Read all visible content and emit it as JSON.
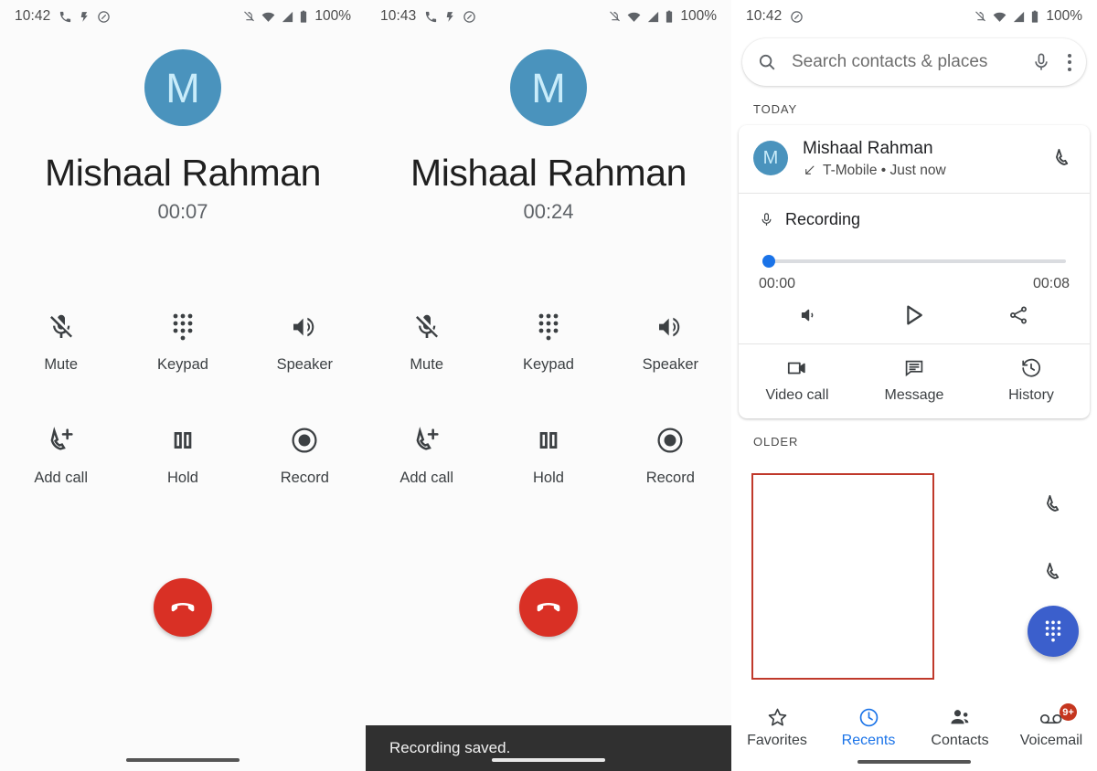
{
  "panels": {
    "call_a": {
      "status": {
        "time": "10:42",
        "battery": "100%",
        "icons_left": [
          "phone-icon",
          "bolt-icon",
          "do-not-disturb-icon"
        ],
        "icons_right": [
          "notifications-off-icon",
          "wifi-icon",
          "signal-icon",
          "battery-icon"
        ]
      },
      "avatar_letter": "M",
      "name": "Mishaal Rahman",
      "timer": "00:07",
      "controls": [
        {
          "label": "Mute",
          "icon": "mic-off-icon"
        },
        {
          "label": "Keypad",
          "icon": "dialpad-icon"
        },
        {
          "label": "Speaker",
          "icon": "speaker-icon"
        },
        {
          "label": "Add call",
          "icon": "add-call-icon"
        },
        {
          "label": "Hold",
          "icon": "pause-icon"
        },
        {
          "label": "Record",
          "icon": "record-icon"
        }
      ],
      "end_call_icon": "call-end-icon"
    },
    "call_b": {
      "status": {
        "time": "10:43",
        "battery": "100%"
      },
      "avatar_letter": "M",
      "name": "Mishaal Rahman",
      "timer": "00:24",
      "controls": [
        {
          "label": "Mute",
          "icon": "mic-off-icon"
        },
        {
          "label": "Keypad",
          "icon": "dialpad-icon"
        },
        {
          "label": "Speaker",
          "icon": "speaker-icon"
        },
        {
          "label": "Add call",
          "icon": "add-call-icon"
        },
        {
          "label": "Hold",
          "icon": "pause-icon"
        },
        {
          "label": "Record",
          "icon": "record-icon"
        }
      ],
      "end_call_icon": "call-end-icon",
      "toast": "Recording saved."
    },
    "recents": {
      "status": {
        "time": "10:42",
        "battery": "100%"
      },
      "search": {
        "placeholder": "Search contacts & places",
        "value": ""
      },
      "sections": {
        "today": "TODAY",
        "older": "OLDER"
      },
      "entry": {
        "avatar_letter": "M",
        "name": "Mishaal Rahman",
        "subtitle": "T-Mobile • Just now",
        "direction_icon": "call-received-icon",
        "call_back_icon": "phone-icon"
      },
      "recording": {
        "title": "Recording",
        "mic_icon": "mic-icon",
        "elapsed": "00:00",
        "duration": "00:08",
        "progress_percent": 0,
        "volume_icon": "volume-icon",
        "play_icon": "play-icon",
        "share_icon": "share-icon"
      },
      "actions": [
        {
          "label": "Video call",
          "icon": "video-call-icon"
        },
        {
          "label": "Message",
          "icon": "message-icon"
        },
        {
          "label": "History",
          "icon": "history-icon"
        }
      ],
      "older_items": [
        {
          "redacted": true,
          "call_icon": "phone-icon"
        },
        {
          "redacted": true,
          "call_icon": "phone-icon"
        }
      ],
      "fab": {
        "icon": "dialpad-icon",
        "color": "#3b5fcc"
      },
      "nav": [
        {
          "label": "Favorites",
          "icon": "star-icon",
          "active": false,
          "badge": ""
        },
        {
          "label": "Recents",
          "icon": "clock-icon",
          "active": true,
          "badge": ""
        },
        {
          "label": "Contacts",
          "icon": "people-icon",
          "active": false,
          "badge": ""
        },
        {
          "label": "Voicemail",
          "icon": "voicemail-icon",
          "active": false,
          "badge": "9+"
        }
      ]
    }
  },
  "colors": {
    "avatar_blue": "#4a93bd",
    "avatar_letter": "#c9ecfa",
    "end_call_red": "#d93025",
    "accent_blue": "#1a73e8",
    "fab_blue": "#3b5fcc",
    "badge_red": "#c5361f",
    "redaction_red": "#c0392b"
  }
}
